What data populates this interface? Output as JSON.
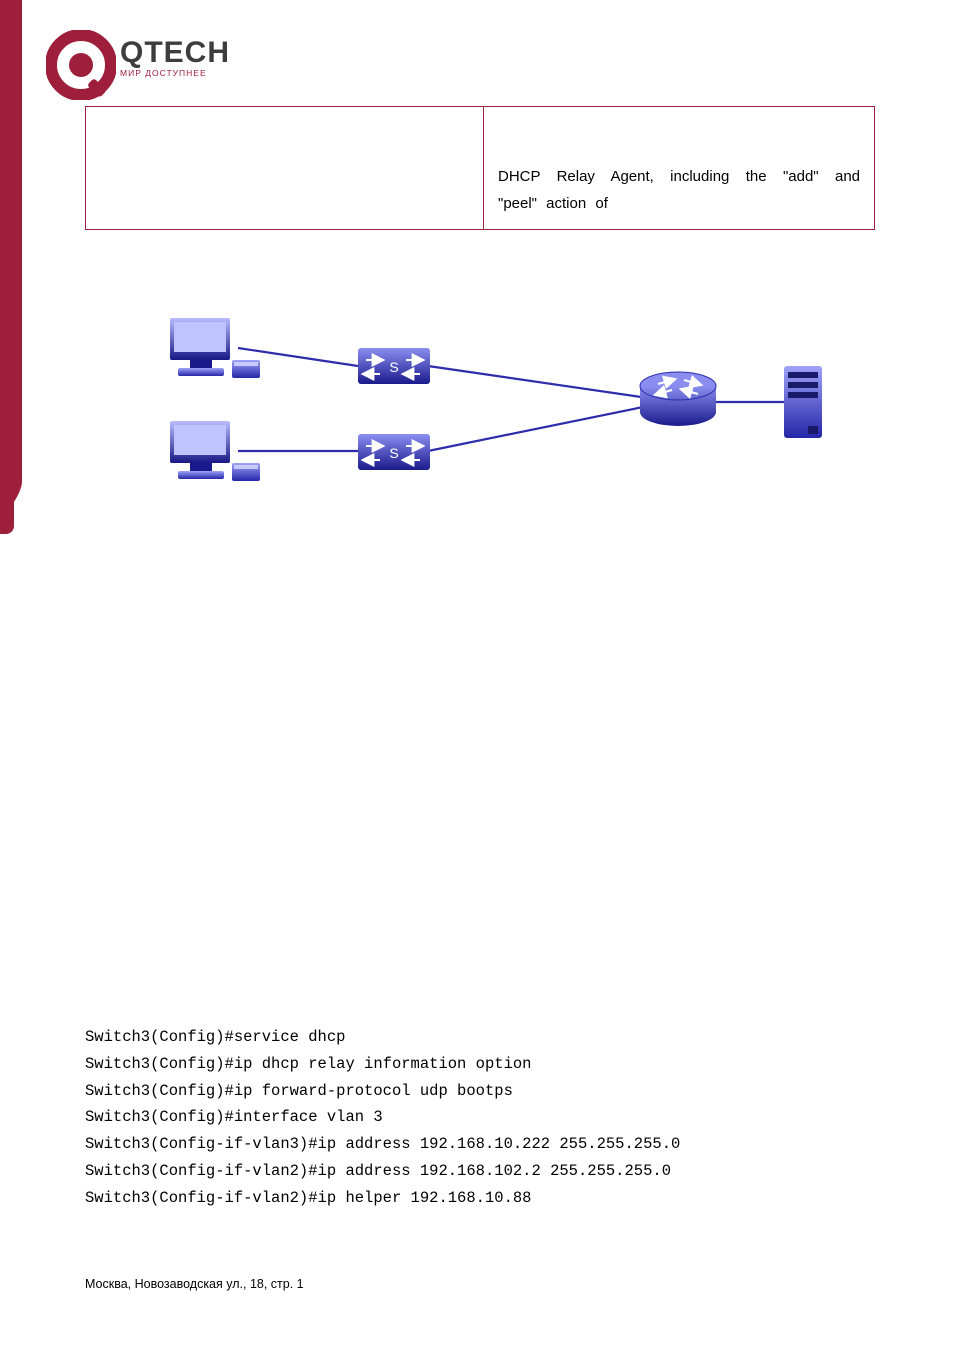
{
  "logo": {
    "brand": "QTECH",
    "tagline": "МИР ДОСТУПНЕЕ"
  },
  "table": {
    "right_cell_text": "DHCP Relay Agent, including the \"add\" and \"peel\" action of"
  },
  "diagram": {
    "nodes": {
      "pc_top_left": "client-pc-1",
      "pc_bottom_left": "client-pc-2",
      "relay_top": "switch-relay-1",
      "relay_bottom": "switch-relay-2",
      "switch_right": "layer3-switch",
      "server": "dhcp-server"
    },
    "labels": {
      "relay_top": "S",
      "relay_bottom": "S"
    }
  },
  "code": {
    "lines": [
      "Switch3(Config)#service dhcp",
      "Switch3(Config)#ip dhcp relay information option",
      "Switch3(Config)#ip forward-protocol udp bootps",
      "Switch3(Config)#interface vlan 3",
      "Switch3(Config-if-vlan3)#ip address 192.168.10.222 255.255.255.0",
      "Switch3(Config-if-vlan2)#ip address 192.168.102.2 255.255.255.0",
      "Switch3(Config-if-vlan2)#ip helper 192.168.10.88"
    ]
  },
  "footer": {
    "text": "Москва, Новозаводская ул., 18, стр. 1"
  }
}
